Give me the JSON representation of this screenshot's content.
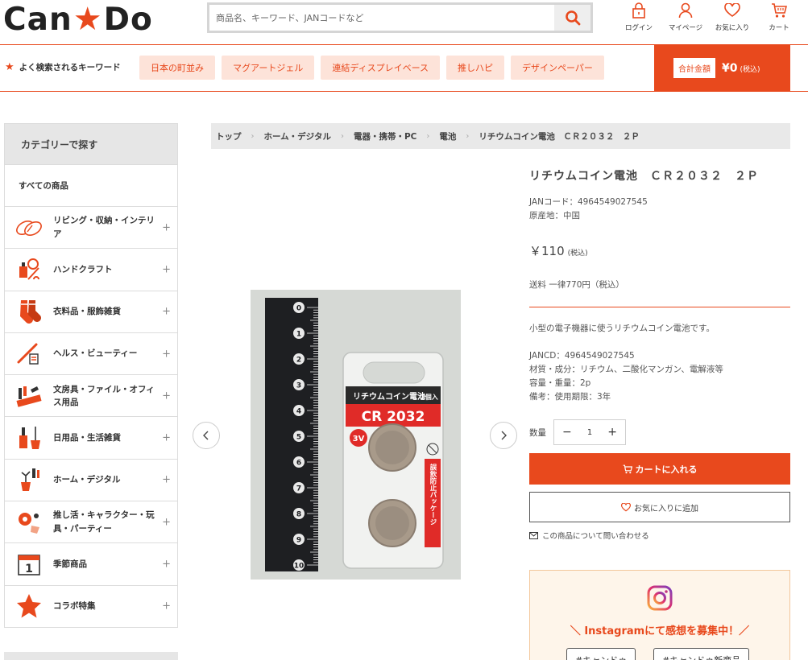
{
  "header": {
    "logo_left": "Can",
    "logo_right": "Do",
    "search_placeholder": "商品名、キーワード、JANコードなど",
    "icons": [
      {
        "label": "ログイン",
        "icon": "lock-icon"
      },
      {
        "label": "マイページ",
        "icon": "user-icon"
      },
      {
        "label": "お気に入り",
        "icon": "heart-icon"
      },
      {
        "label": "カート",
        "icon": "cart-icon"
      }
    ]
  },
  "keywords": {
    "title": "よく検索されるキーワード",
    "chips": [
      "日本の町並み",
      "マグアートジェル",
      "連結ディスプレイベース",
      "推しハピ",
      "デザインペーパー"
    ]
  },
  "cart_total": {
    "label": "合計金額",
    "value": "¥0",
    "tax": "(税込)"
  },
  "sidebar": {
    "heading": "カテゴリーで探す",
    "all_label": "すべての商品",
    "items": [
      {
        "label": "リビング・収納・インテリア",
        "icon": "living-icon"
      },
      {
        "label": "ハンドクラフト",
        "icon": "handcraft-icon"
      },
      {
        "label": "衣料品・服飾雑貨",
        "icon": "clothing-icon"
      },
      {
        "label": "ヘルス・ビューティー",
        "icon": "beauty-icon"
      },
      {
        "label": "文房具・ファイル・オフィス用品",
        "icon": "stationery-icon"
      },
      {
        "label": "日用品・生活雑貨",
        "icon": "household-icon"
      },
      {
        "label": "ホーム・デジタル",
        "icon": "home-digital-icon"
      },
      {
        "label": "推し活・キャラクター・玩具・パーティー",
        "icon": "toys-icon"
      },
      {
        "label": "季節商品",
        "icon": "calendar-icon"
      },
      {
        "label": "コラボ特集",
        "icon": "star-icon"
      }
    ]
  },
  "breadcrumb": [
    "トップ",
    "ホーム・デジタル",
    "電器・携帯・PC",
    "電池",
    "リチウムコイン電池　ＣＲ２０３２　２Ｐ"
  ],
  "product": {
    "title": "リチウムコイン電池　ＣＲ２０３２　２Ｐ",
    "jan": "JANコード：4964549027545",
    "origin": "原産地：中国",
    "price": "￥110",
    "price_tax": "(税込)",
    "shipping": "送料 一律770円（税込）",
    "description": "小型の電子機器に使うリチウムコイン電池です。",
    "specs": [
      "JANCD：4964549027545",
      "材質・成分：リチウム、二酸化マンガン、電解液等",
      "容量・重量：2p",
      "備考：使用期限：3年"
    ],
    "qty_label": "数量",
    "qty_value": "1",
    "cart_button": "カートに入れる",
    "fav_button": "お気に入りに追加",
    "contact": "この商品について問い合わせる"
  },
  "product_image": {
    "package_title": "リチウムコイン電池",
    "package_count": "2個入",
    "package_model": "CR 2032",
    "package_voltage": "3V",
    "package_note": "誤飲防止パッケージ",
    "ruler_numbers": [
      "0",
      "1",
      "2",
      "3",
      "4",
      "5",
      "6",
      "7",
      "8",
      "9",
      "10"
    ]
  },
  "instagram": {
    "text": "＼ Instagramにて感想を募集中！／",
    "tags": [
      "#キャンドゥ",
      "#キャンドゥ新商品"
    ]
  },
  "colors": {
    "brand": "#e8491d",
    "chip_bg": "#fde3d9",
    "sidebar_head": "#e6e6e6"
  }
}
